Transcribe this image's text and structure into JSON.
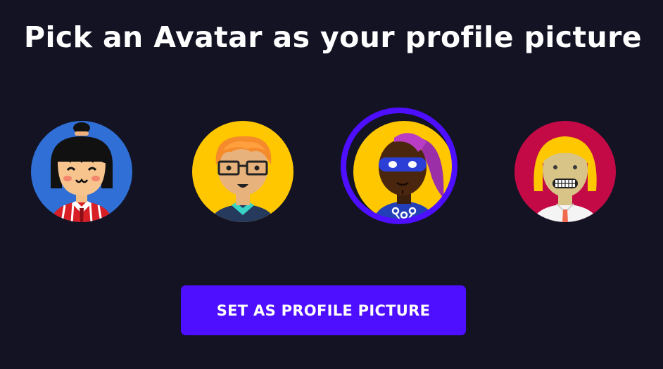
{
  "title": "Pick an Avatar as your profile picture",
  "avatars": [
    {
      "name": "avatar-girl-topknot",
      "background": "#2f6fd6",
      "selected": false
    },
    {
      "name": "avatar-boy-glasses",
      "background": "#ffc700",
      "selected": false
    },
    {
      "name": "avatar-masked-hero",
      "background": "#ffc700",
      "selected": true
    },
    {
      "name": "avatar-blonde-grin",
      "background": "#c40a46",
      "selected": false
    }
  ],
  "accent_color": "#4e0eff",
  "background_color": "#131324",
  "submit_button": {
    "label": "SET AS PROFILE PICTURE"
  }
}
